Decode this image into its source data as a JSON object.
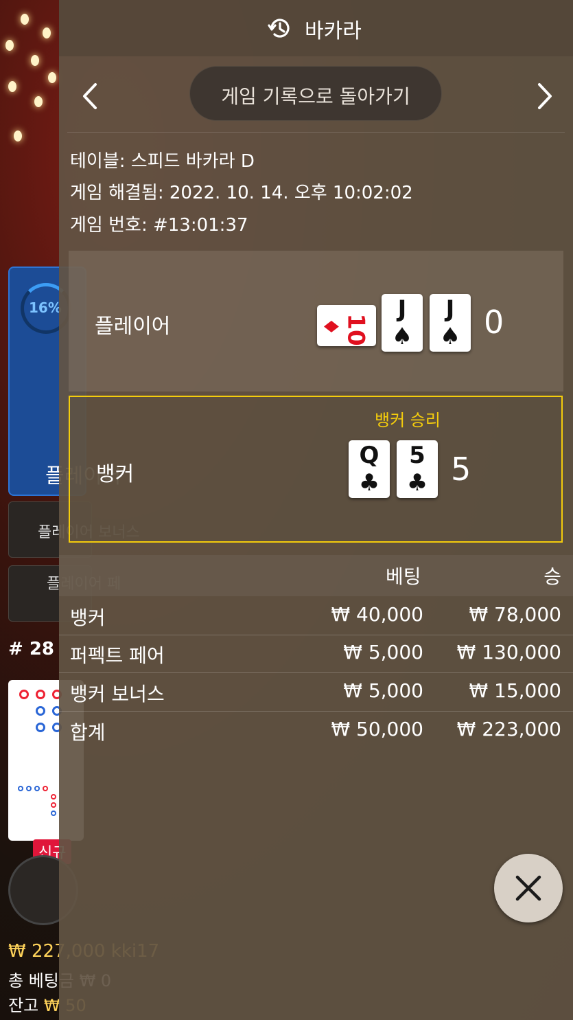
{
  "background": {
    "progress_percent": "16%",
    "player_label": "플레이어",
    "player_bonus_label": "플레이어 보너스",
    "player_pair_label": "플레이어 페",
    "round_label": "# 28",
    "new_badge": "신규",
    "balance_line": "₩ 227,000 kki17",
    "total_bet_label": "총 베팅금 ₩ 0",
    "remaining_label": "잔고",
    "remaining_value": "₩ 50",
    "accent_blue": "#1c4c96"
  },
  "header": {
    "icon": "history-icon",
    "title": "바카라"
  },
  "nav": {
    "back_label": "게임 기록으로 돌아가기",
    "prev_icon": "chevron-left-icon",
    "next_icon": "chevron-right-icon"
  },
  "info": {
    "table": "테이블: 스피드 바카라 D",
    "resolved": "게임 해결됨: 2022. 10. 14. 오후 10:02:02",
    "round": "게임 번호: #13:01:37"
  },
  "player": {
    "label": "플레이어",
    "score": "0",
    "cards": [
      {
        "rank": "10",
        "suit": "♦",
        "color": "red",
        "orientation": "sideways"
      },
      {
        "rank": "J",
        "suit": "♠",
        "color": "black",
        "orientation": "upright"
      },
      {
        "rank": "J",
        "suit": "♠",
        "color": "black",
        "orientation": "upright"
      }
    ]
  },
  "banker": {
    "label": "뱅커",
    "result": "뱅커 승리",
    "score": "5",
    "highlight_color": "#f5cd0c",
    "cards": [
      {
        "rank": "Q",
        "suit": "♣",
        "color": "black",
        "orientation": "upright"
      },
      {
        "rank": "5",
        "suit": "♣",
        "color": "black",
        "orientation": "upright"
      }
    ]
  },
  "bets": {
    "col_bet": "베팅",
    "col_win": "승",
    "rows": [
      {
        "name": "뱅커",
        "bet": "₩ 40,000",
        "win": "₩ 78,000"
      },
      {
        "name": "퍼펙트 페어",
        "bet": "₩ 5,000",
        "win": "₩ 130,000"
      },
      {
        "name": "뱅커 보너스",
        "bet": "₩ 5,000",
        "win": "₩ 15,000"
      },
      {
        "name": "합계",
        "bet": "₩ 50,000",
        "win": "₩ 223,000"
      }
    ]
  },
  "close": {
    "icon": "close-icon"
  }
}
